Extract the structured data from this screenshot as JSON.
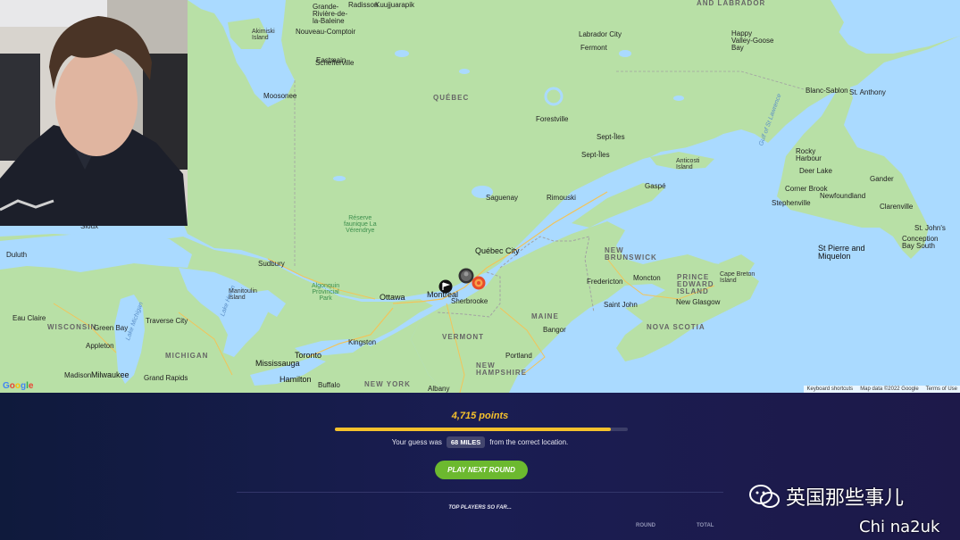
{
  "map": {
    "region_labels": [
      {
        "text": "AND LABRADOR",
        "cls": "big"
      },
      {
        "text": "QUÉBEC",
        "cls": "big"
      },
      {
        "text": "NEW\nBRUNSWICK",
        "cls": "big"
      },
      {
        "text": "PRINCE\nEDWARD\nISLAND",
        "cls": "big"
      },
      {
        "text": "NOVA SCOTIA",
        "cls": "big"
      },
      {
        "text": "MAINE",
        "cls": "big"
      },
      {
        "text": "VERMONT",
        "cls": "big"
      },
      {
        "text": "NEW\nHAMPSHIRE",
        "cls": "big"
      },
      {
        "text": "NEW YORK",
        "cls": "big"
      },
      {
        "text": "MICHIGAN",
        "cls": "big"
      },
      {
        "text": "WISCONSIN",
        "cls": "big"
      }
    ],
    "city_labels": [
      {
        "text": "Québec City",
        "cls": "bigcity"
      },
      {
        "text": "Montreal",
        "cls": "bigcity"
      },
      {
        "text": "Ottawa",
        "cls": "bigcity"
      },
      {
        "text": "Toronto",
        "cls": "bigcity"
      },
      {
        "text": "Mississauga",
        "cls": "bigcity"
      },
      {
        "text": "Hamilton",
        "cls": "bigcity"
      },
      {
        "text": "Milwaukee",
        "cls": "bigcity"
      },
      {
        "text": "St Pierre and\nMiquelon",
        "cls": "bigcity"
      },
      {
        "text": "Sherbrooke",
        "cls": "city"
      },
      {
        "text": "Saguenay",
        "cls": "city"
      },
      {
        "text": "Rimouski",
        "cls": "city"
      },
      {
        "text": "Sept-Îles",
        "cls": "city"
      },
      {
        "text": "Gaspé",
        "cls": "city"
      },
      {
        "text": "Fredericton",
        "cls": "city"
      },
      {
        "text": "Moncton",
        "cls": "city"
      },
      {
        "text": "Saint John",
        "cls": "city"
      },
      {
        "text": "New Glasgow",
        "cls": "city"
      },
      {
        "text": "Bangor",
        "cls": "city"
      },
      {
        "text": "Portland",
        "cls": "city"
      },
      {
        "text": "Kingston",
        "cls": "city"
      },
      {
        "text": "Sudbury",
        "cls": "city"
      },
      {
        "text": "Buffalo",
        "cls": "city"
      },
      {
        "text": "Albany",
        "cls": "city"
      },
      {
        "text": "Grand Rapids",
        "cls": "city"
      },
      {
        "text": "Madison",
        "cls": "city"
      },
      {
        "text": "Green Bay",
        "cls": "city"
      },
      {
        "text": "Appleton",
        "cls": "city"
      },
      {
        "text": "Traverse City",
        "cls": "city"
      },
      {
        "text": "Eau Claire",
        "cls": "city"
      },
      {
        "text": "Duluth",
        "cls": "city"
      },
      {
        "text": "Labrador City",
        "cls": "city"
      },
      {
        "text": "Fermont",
        "cls": "city"
      },
      {
        "text": "Schefferville",
        "cls": "city"
      },
      {
        "text": "Happy\nValley-Goose\nBay",
        "cls": "city"
      },
      {
        "text": "Moosonee",
        "cls": "city"
      },
      {
        "text": "Nouveau-Comptoir",
        "cls": "city"
      },
      {
        "text": "Eastmain",
        "cls": "city"
      },
      {
        "text": "Blanc-Sablon",
        "cls": "city"
      },
      {
        "text": "St. Anthony",
        "cls": "city"
      },
      {
        "text": "Rocky\nHarbour",
        "cls": "city"
      },
      {
        "text": "Deer Lake",
        "cls": "city"
      },
      {
        "text": "Corner Brook",
        "cls": "city"
      },
      {
        "text": "Stephenville",
        "cls": "city"
      },
      {
        "text": "Gander",
        "cls": "city"
      },
      {
        "text": "Clarenville",
        "cls": "city"
      },
      {
        "text": "St. John's",
        "cls": "city"
      },
      {
        "text": "Conception\nBay South",
        "cls": "city"
      },
      {
        "text": "Newfoundland",
        "cls": "city"
      },
      {
        "text": "Grande-\nRivière-de-\nla-Baleine",
        "cls": "city"
      },
      {
        "text": "Radisson",
        "cls": "city"
      },
      {
        "text": "Kuujjuarapik",
        "cls": "city"
      },
      {
        "text": "Anticosti\nIsland",
        "cls": "isl"
      },
      {
        "text": "Akimiski\nIsland",
        "cls": "isl"
      },
      {
        "text": "Cape Breton\nIsland",
        "cls": "isl"
      },
      {
        "text": "Gulf of St Lawrence",
        "cls": "water"
      },
      {
        "text": "Lake Michigan",
        "cls": "water"
      },
      {
        "text": "Lake Huron",
        "cls": "water"
      },
      {
        "text": "Algonquin\nProvincial\nPark",
        "cls": "park"
      },
      {
        "text": "Réserve\nfaunique La\nVérendrye",
        "cls": "park"
      },
      {
        "text": "Manitoulin\nIsland",
        "cls": "isl"
      },
      {
        "text": "Sept-Îles",
        "cls": "city"
      },
      {
        "text": "Forestville",
        "cls": "city"
      },
      {
        "text": "Sioux",
        "cls": "city"
      }
    ],
    "google_logo": "Google",
    "attribution": [
      "Keyboard shortcuts",
      "Map data ©2022 Google",
      "Terms of Use"
    ]
  },
  "result": {
    "points_text": "4,715 points",
    "progress_fraction": 0.943,
    "guess_prefix": "Your guess was",
    "distance": "68 MILES",
    "guess_suffix": "from the correct location.",
    "play_next_label": "PLAY NEXT ROUND",
    "top_players_label": "TOP PLAYERS SO FAR...",
    "col_round": "ROUND",
    "col_total": "TOTAL"
  },
  "overlay": {
    "wechat_text": "英国那些事儿",
    "site_text": "Chi na2uk"
  },
  "colors": {
    "land": "#b8e0a6",
    "forest": "#9ed29a",
    "water": "#aadaff",
    "accent_yellow": "#f5c12c",
    "button_green": "#6cb92f",
    "panel_bg": "#1a1d52"
  },
  "icons": {
    "guess_marker": "flag-marker-icon",
    "correct_marker": "target-marker-icon",
    "player_marker": "avatar-marker-icon"
  }
}
